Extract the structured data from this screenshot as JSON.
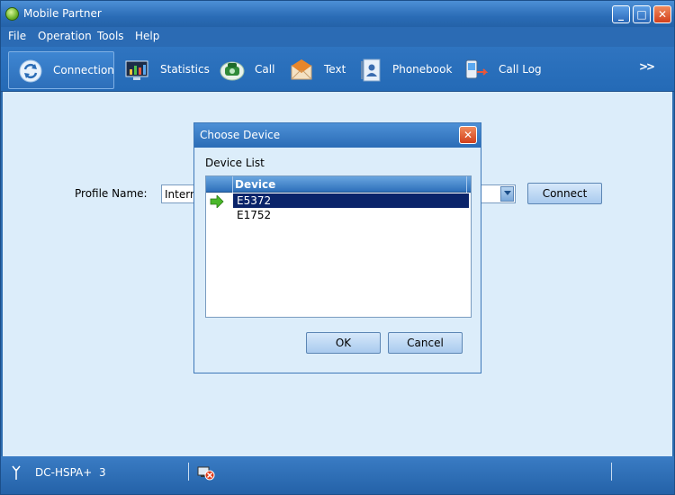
{
  "window": {
    "title": "Mobile Partner",
    "minimize_glyph": "_",
    "maximize_glyph": "□",
    "close_glyph": "✕"
  },
  "menu": {
    "items": [
      "File",
      "Operation",
      "Tools",
      "Help"
    ]
  },
  "toolbar": {
    "items": [
      {
        "label": "Connection",
        "icon": "connection-icon",
        "active": true
      },
      {
        "label": "Statistics",
        "icon": "statistics-icon"
      },
      {
        "label": "Call",
        "icon": "phone-icon"
      },
      {
        "label": "Text",
        "icon": "envelope-icon"
      },
      {
        "label": "Phonebook",
        "icon": "phonebook-icon"
      },
      {
        "label": "Call Log",
        "icon": "call-log-icon"
      }
    ],
    "more_glyph": ">>"
  },
  "connection": {
    "profile_label": "Profile Name:",
    "profile_value": "Intern",
    "connect_label": "Connect"
  },
  "dialog": {
    "title": "Choose Device",
    "close_glyph": "✕",
    "list_label": "Device List",
    "column_header": "Device",
    "devices": [
      {
        "name": "E5372",
        "selected": true
      },
      {
        "name": "E1752",
        "selected": false
      }
    ],
    "ok_label": "OK",
    "cancel_label": "Cancel"
  },
  "status": {
    "network": "DC-HSPA+",
    "signal_count": "3",
    "connection_icon": "disconnected-icon"
  },
  "colors": {
    "title_blue": "#2a6cb6",
    "content_bg": "#dcedfa",
    "selection": "#0a246a",
    "close_red": "#d2401c"
  }
}
